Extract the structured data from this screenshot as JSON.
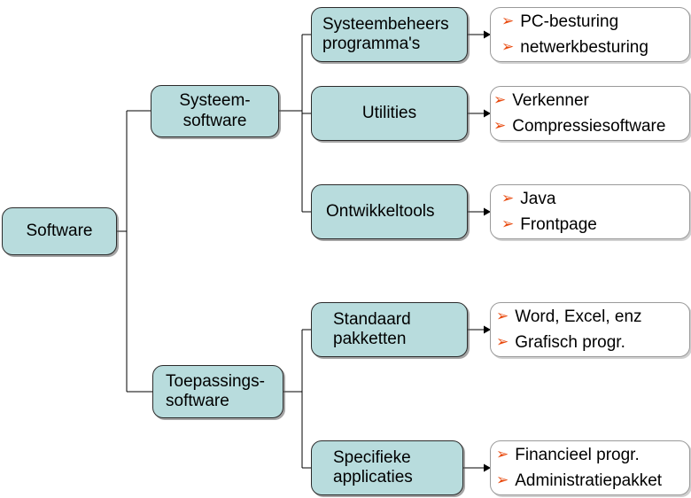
{
  "diagram": {
    "title": "Software",
    "root": {
      "label": "Software"
    },
    "branches": [
      {
        "label": "Systeem-\nsoftware",
        "children": [
          {
            "label": "Systeembeheers\nprogramma's",
            "items": [
              "PC-besturing",
              "netwerkbesturing"
            ]
          },
          {
            "label": "Utilities",
            "items": [
              "Verkenner",
              "Compressiesoftware"
            ]
          },
          {
            "label": "Ontwikkeltools",
            "items": [
              "Java",
              "Frontpage"
            ]
          }
        ]
      },
      {
        "label": "Toepassings-\nsoftware",
        "children": [
          {
            "label": "Standaard\npakketten",
            "items": [
              "Word, Excel, enz",
              "Grafisch progr."
            ]
          },
          {
            "label": "Specifieke\napplicaties",
            "items": [
              "Financieel progr.",
              "Administratiepakket"
            ]
          }
        ]
      }
    ],
    "bullet_glyph": "➢",
    "colors": {
      "node_fill": "#b8dcdd",
      "node_border": "#2b2b2b",
      "leaf_fill": "#ffffff",
      "leaf_border": "#9a9a9a",
      "bullet": "#e8480c",
      "line": "#000000",
      "background": "#ffffff"
    }
  }
}
